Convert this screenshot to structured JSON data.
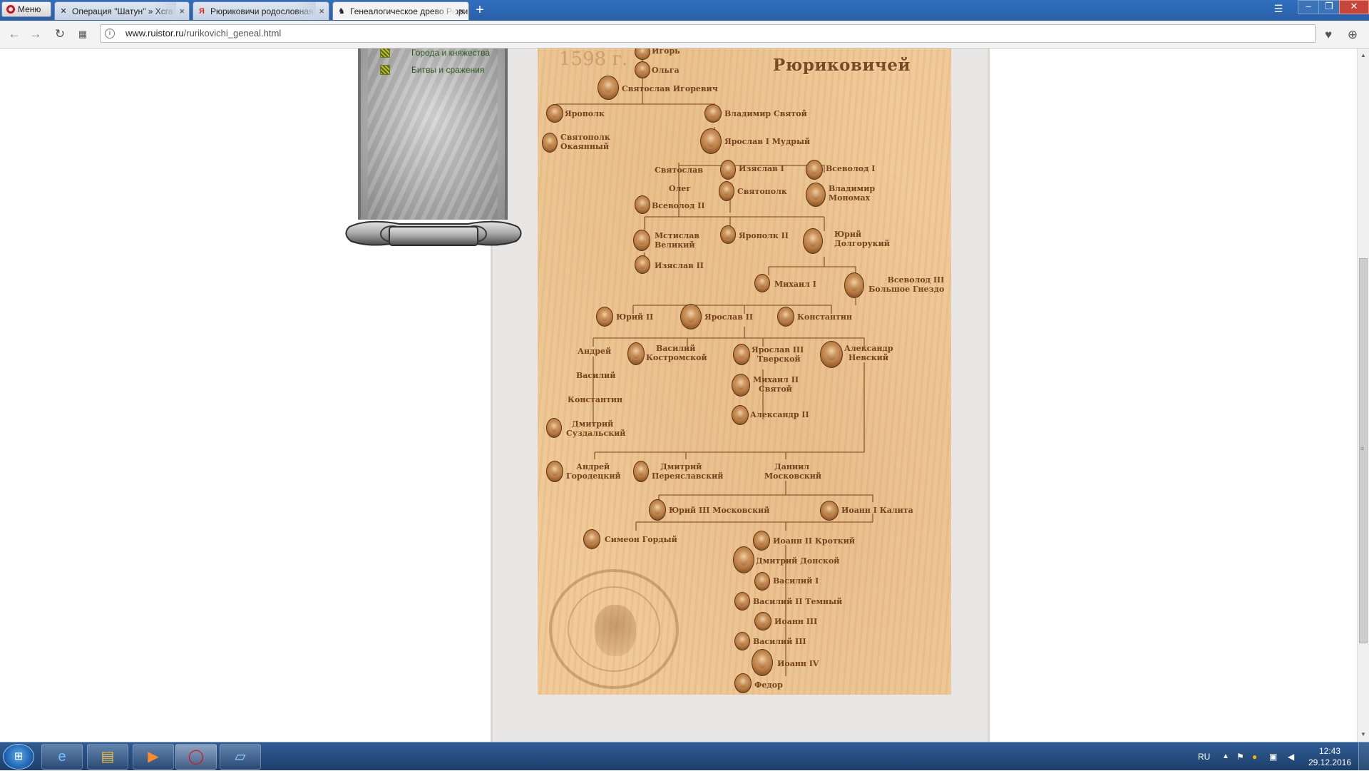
{
  "browser": {
    "menu_label": "Меню",
    "tabs": [
      {
        "title": "Операция \"Шатун\" » Хсга",
        "icon": "spider-favicon-icon",
        "glyph": "✕"
      },
      {
        "title": "Рюриковичи родословная",
        "icon": "yandex-favicon-icon",
        "glyph": "Я"
      },
      {
        "title": "Генеалогическое древо Рюриковичей",
        "icon": "horseman-favicon-icon",
        "glyph": "♞"
      }
    ],
    "new_tab": "+",
    "url_host": "www.ruistor.ru",
    "url_path": "/rurikovichi_geneal.html"
  },
  "sidebar": {
    "items": [
      {
        "label": "Города и княжества"
      },
      {
        "label": "Битвы и сражения"
      }
    ]
  },
  "tree": {
    "title": "Рюриковичей",
    "year": "1598 г.",
    "persons": [
      {
        "id": "igor",
        "line1": "Игорь",
        "line2": ""
      },
      {
        "id": "olga",
        "line1": "Ольга",
        "line2": ""
      },
      {
        "id": "svyatoslav-igorevich",
        "line1": "Святослав Игоревич",
        "line2": ""
      },
      {
        "id": "yaropolk",
        "line1": "Ярополк",
        "line2": ""
      },
      {
        "id": "vladimir-svyatoy",
        "line1": "Владимир Святой",
        "line2": ""
      },
      {
        "id": "svyatopolk-okayanny",
        "line1": "Святополк",
        "line2": "Окаянный"
      },
      {
        "id": "yaroslav-mudry",
        "line1": "Ярослав I Мудрый",
        "line2": ""
      },
      {
        "id": "svyatoslav",
        "line1": "Святослав",
        "line2": ""
      },
      {
        "id": "izyaslav-1",
        "line1": "Изяслав I",
        "line2": ""
      },
      {
        "id": "vsevolod-1",
        "line1": "Всеволод I",
        "line2": ""
      },
      {
        "id": "oleg",
        "line1": "Олег",
        "line2": ""
      },
      {
        "id": "svyatopolk",
        "line1": "Святополк",
        "line2": ""
      },
      {
        "id": "vladimir-monomakh",
        "line1": "Владимир",
        "line2": "Мономах"
      },
      {
        "id": "vsevolod-2",
        "line1": "Всеволод II",
        "line2": ""
      },
      {
        "id": "mstislav",
        "line1": "Мстислав",
        "line2": "Великий"
      },
      {
        "id": "yaropolk-2",
        "line1": "Ярополк II",
        "line2": ""
      },
      {
        "id": "yury-dolgoruky",
        "line1": "Юрий",
        "line2": "Долгорукий"
      },
      {
        "id": "izyaslav-2",
        "line1": "Изяслав II",
        "line2": ""
      },
      {
        "id": "mikhail-1",
        "line1": "Михаил I",
        "line2": ""
      },
      {
        "id": "vsevolod-3",
        "line1": "Всеволод III",
        "line2": "Большое Гнездо"
      },
      {
        "id": "yury-2",
        "line1": "Юрий II",
        "line2": ""
      },
      {
        "id": "yaroslav-2",
        "line1": "Ярослав II",
        "line2": ""
      },
      {
        "id": "konstantin",
        "line1": "Константин",
        "line2": ""
      },
      {
        "id": "andrey",
        "line1": "Андрей",
        "line2": ""
      },
      {
        "id": "vasily-kostromskoy",
        "line1": "Василий",
        "line2": "Костромской"
      },
      {
        "id": "yaroslav-3",
        "line1": "Ярослав III",
        "line2": "Тверской"
      },
      {
        "id": "alexander-nevsky",
        "line1": "Александр",
        "line2": "Невский"
      },
      {
        "id": "vasily",
        "line1": "Василий",
        "line2": ""
      },
      {
        "id": "mikhail-2",
        "line1": "Михаил II",
        "line2": "Святой"
      },
      {
        "id": "konstantin-2",
        "line1": "Константин",
        "line2": ""
      },
      {
        "id": "alexander-2",
        "line1": "Александр II",
        "line2": ""
      },
      {
        "id": "dmitry-suzdalsky",
        "line1": "Дмитрий",
        "line2": "Суздальский"
      },
      {
        "id": "andrey-gorodetsky",
        "line1": "Андрей",
        "line2": "Городецкий"
      },
      {
        "id": "dmitry-pereslavsky",
        "line1": "Дмитрий",
        "line2": "Переяславский"
      },
      {
        "id": "daniil-moskovsky",
        "line1": "Даниил",
        "line2": "Московский"
      },
      {
        "id": "yury-3",
        "line1": "Юрий III Московский",
        "line2": ""
      },
      {
        "id": "ioann-kalita",
        "line1": "Иоанн I Калита",
        "line2": ""
      },
      {
        "id": "simeon-gordy",
        "line1": "Симеон  Гордый",
        "line2": ""
      },
      {
        "id": "ioann-2",
        "line1": "Иоанн II Кроткий",
        "line2": ""
      },
      {
        "id": "dmitry-donskoy",
        "line1": "Дмитрий  Донской",
        "line2": ""
      },
      {
        "id": "vasily-1",
        "line1": "Василий I",
        "line2": ""
      },
      {
        "id": "vasily-2",
        "line1": "Василий II  Темный",
        "line2": ""
      },
      {
        "id": "ioann-3",
        "line1": "Иоанн III",
        "line2": ""
      },
      {
        "id": "vasily-3",
        "line1": "Василий III",
        "line2": ""
      },
      {
        "id": "ioann-4",
        "line1": "Иоанн IV",
        "line2": ""
      },
      {
        "id": "fedor",
        "line1": "Федор",
        "line2": ""
      }
    ]
  },
  "taskbar": {
    "lang": "RU",
    "time": "12:43",
    "date": "29.12.2016"
  },
  "colors": {
    "parchment": "#efc896",
    "ink": "#74421c",
    "tabbar": "#2f6fbf",
    "menu_link": "#2b5b1f"
  }
}
